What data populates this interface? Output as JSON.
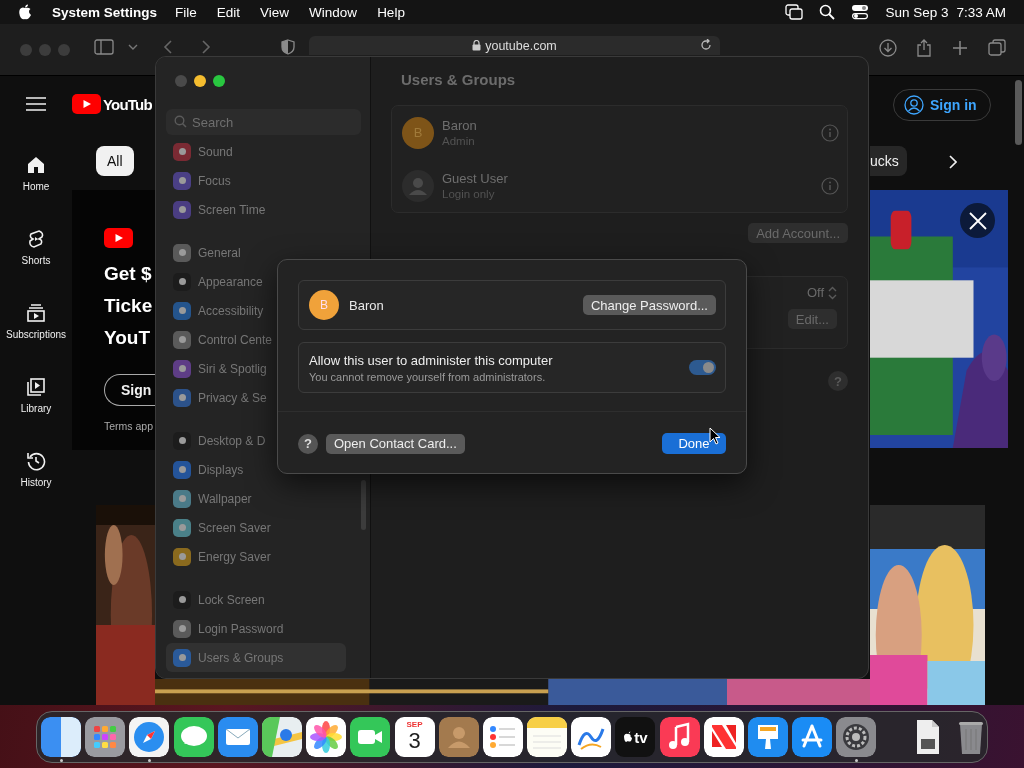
{
  "menu_bar": {
    "app_name": "System Settings",
    "menus": [
      "File",
      "Edit",
      "View",
      "Window",
      "Help"
    ],
    "date": "Sun Sep 3",
    "time": "7:33 AM"
  },
  "browser": {
    "address": "youtube.com",
    "logo_text": "YouTub",
    "nav": [
      {
        "label": "Home",
        "kind": "home"
      },
      {
        "label": "Shorts",
        "kind": "shorts"
      },
      {
        "label": "Subscriptions",
        "kind": "subscriptions"
      },
      {
        "label": "Library",
        "kind": "library"
      },
      {
        "label": "History",
        "kind": "history"
      }
    ],
    "left_chip": {
      "label": "All",
      "selected": true
    },
    "right_chip": {
      "label": "ucks",
      "selected": false
    },
    "banner": {
      "lines": [
        "Get $",
        "Ticke",
        "YouT"
      ],
      "button": "Sign",
      "note": "Terms app"
    },
    "sign_in": "Sign in"
  },
  "settings": {
    "search_placeholder": "Search",
    "sidebar": [
      {
        "items": [
          {
            "label": "Sound",
            "color": "#7a2a33",
            "selected": false
          },
          {
            "label": "Focus",
            "color": "#4a3f85",
            "selected": false
          },
          {
            "label": "Screen Time",
            "color": "#4a3d82",
            "selected": false
          }
        ]
      },
      {
        "items": [
          {
            "label": "General",
            "color": "#5a5a5a",
            "selected": false
          },
          {
            "label": "Appearance",
            "color": "#1c1c1c",
            "selected": false
          },
          {
            "label": "Accessibility",
            "color": "#24548c",
            "selected": false
          },
          {
            "label": "Control Cente",
            "color": "#5a5a5a",
            "selected": false
          },
          {
            "label": "Siri & Spotlig",
            "color": "#5e3d86",
            "selected": false
          },
          {
            "label": "Privacy & Se",
            "color": "#2c528a",
            "selected": false
          }
        ]
      },
      {
        "items": [
          {
            "label": "Desktop & D",
            "color": "#1c1c1c",
            "selected": false
          },
          {
            "label": "Displays",
            "color": "#24549a",
            "selected": false
          },
          {
            "label": "Wallpaper",
            "color": "#4a7a88",
            "selected": false
          },
          {
            "label": "Screen Saver",
            "color": "#4a8088",
            "selected": false
          },
          {
            "label": "Energy Saver",
            "color": "#8a6a1e",
            "selected": false
          }
        ]
      },
      {
        "items": [
          {
            "label": "Lock Screen",
            "color": "#1c1c1c",
            "selected": false
          },
          {
            "label": "Login Password",
            "color": "#5a5a5a",
            "selected": false
          },
          {
            "label": "Users & Groups",
            "color": "#2a5a9a",
            "selected": true
          }
        ]
      }
    ],
    "title": "Users & Groups",
    "users": [
      {
        "kind": "initial",
        "avatar": "B",
        "name": "Baron",
        "role": "Admin"
      },
      {
        "kind": "guest",
        "name": "Guest User",
        "role": "Login only"
      }
    ],
    "add_account": "Add Account...",
    "auto_login": "Off",
    "edit_button": "Edit...",
    "help": "?"
  },
  "sheet": {
    "avatar": "B",
    "user_name": "Baron",
    "change_password": "Change Password...",
    "admin": {
      "label": "Allow this user to administer this computer",
      "note": "You cannot remove yourself from administrators.",
      "on": true
    },
    "help": "?",
    "open_contact": "Open Contact Card...",
    "done": "Done"
  },
  "dock": {
    "items": [
      {
        "kind": "finder",
        "running": true
      },
      {
        "kind": "launchpad",
        "running": false
      },
      {
        "kind": "safari",
        "running": true
      },
      {
        "kind": "messages",
        "running": false
      },
      {
        "kind": "mail",
        "running": false
      },
      {
        "kind": "maps",
        "running": false
      },
      {
        "kind": "photos",
        "running": false
      },
      {
        "kind": "facetime",
        "running": false
      },
      {
        "kind": "calendar",
        "running": false,
        "month": "SEP",
        "day": "3"
      },
      {
        "kind": "contacts",
        "running": false
      },
      {
        "kind": "reminders",
        "running": false
      },
      {
        "kind": "notes",
        "running": false
      },
      {
        "kind": "freeform",
        "running": false
      },
      {
        "kind": "tv",
        "running": false,
        "label": "tv"
      },
      {
        "kind": "music",
        "running": false
      },
      {
        "kind": "news",
        "running": false
      },
      {
        "kind": "keynote",
        "running": false
      },
      {
        "kind": "appstore",
        "running": false
      },
      {
        "kind": "settings",
        "running": true
      }
    ],
    "extras": [
      {
        "kind": "document"
      },
      {
        "kind": "trash"
      }
    ]
  }
}
